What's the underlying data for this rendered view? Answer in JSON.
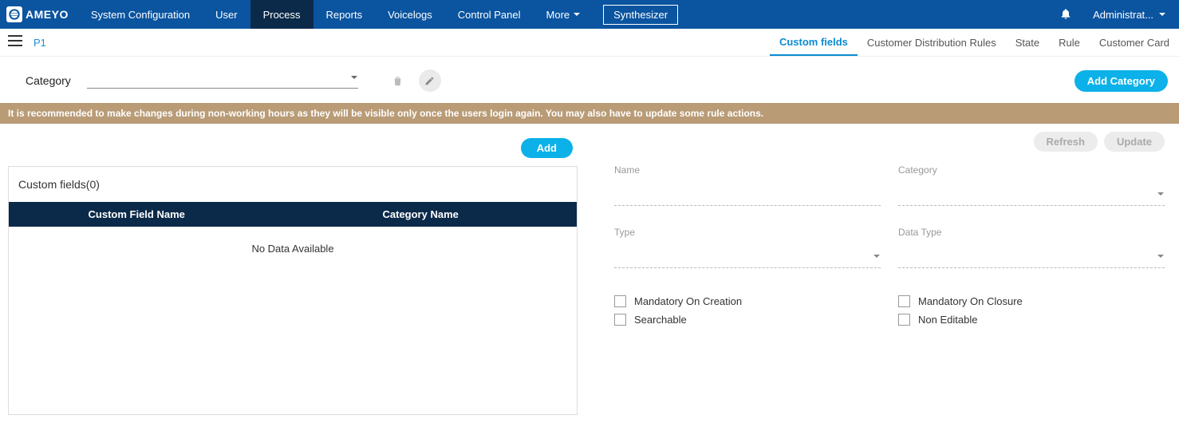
{
  "brand": "AMEYO",
  "nav": {
    "items": [
      "System Configuration",
      "User",
      "Process",
      "Reports",
      "Voicelogs",
      "Control Panel",
      "More"
    ],
    "active_index": 2,
    "synth": "Synthesizer",
    "user": "Administrat..."
  },
  "breadcrumb": "P1",
  "subtabs": {
    "items": [
      "Custom fields",
      "Customer Distribution Rules",
      "State",
      "Rule",
      "Customer Card"
    ],
    "active_index": 0
  },
  "category_row": {
    "label": "Category",
    "add_btn": "Add Category"
  },
  "warn": "It is recommended to make changes during non-working hours as they will be visible only once the users login again. You may also have to update some rule actions.",
  "left_panel": {
    "add_btn": "Add",
    "title": "Custom fields(0)",
    "cols": [
      "Custom Field Name",
      "Category Name"
    ],
    "empty": "No Data Available"
  },
  "right_panel": {
    "refresh": "Refresh",
    "update": "Update",
    "fields": {
      "name": "Name",
      "category": "Category",
      "type": "Type",
      "data_type": "Data Type"
    },
    "checks": {
      "mandatory_creation": "Mandatory On Creation",
      "mandatory_closure": "Mandatory On Closure",
      "searchable": "Searchable",
      "non_editable": "Non Editable"
    }
  }
}
